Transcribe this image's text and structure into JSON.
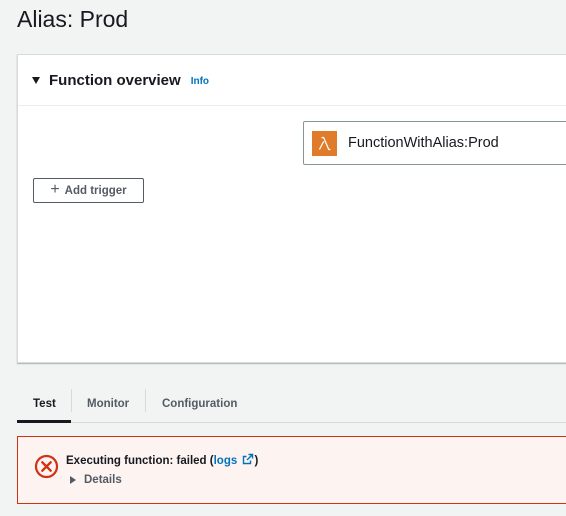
{
  "page": {
    "title": "Alias: Prod"
  },
  "overview": {
    "title": "Function overview",
    "info_label": "Info",
    "function_name": "FunctionWithAlias:Prod",
    "add_trigger_label": "Add trigger"
  },
  "tabs": [
    {
      "label": "Test",
      "active": true
    },
    {
      "label": "Monitor",
      "active": false
    },
    {
      "label": "Configuration",
      "active": false
    }
  ],
  "alert": {
    "message_prefix": "Executing function: failed (",
    "logs_label": "logs",
    "message_suffix": ")",
    "details_label": "Details",
    "status": "error"
  },
  "colors": {
    "accent_link": "#0073bb",
    "lambda_orange": "#e07b29",
    "error_red": "#d13212",
    "error_bg": "#fdf3f1"
  },
  "icons": [
    "caret-down-icon",
    "lambda-icon",
    "plus-icon",
    "error-x-icon",
    "external-link-icon",
    "caret-right-icon"
  ]
}
